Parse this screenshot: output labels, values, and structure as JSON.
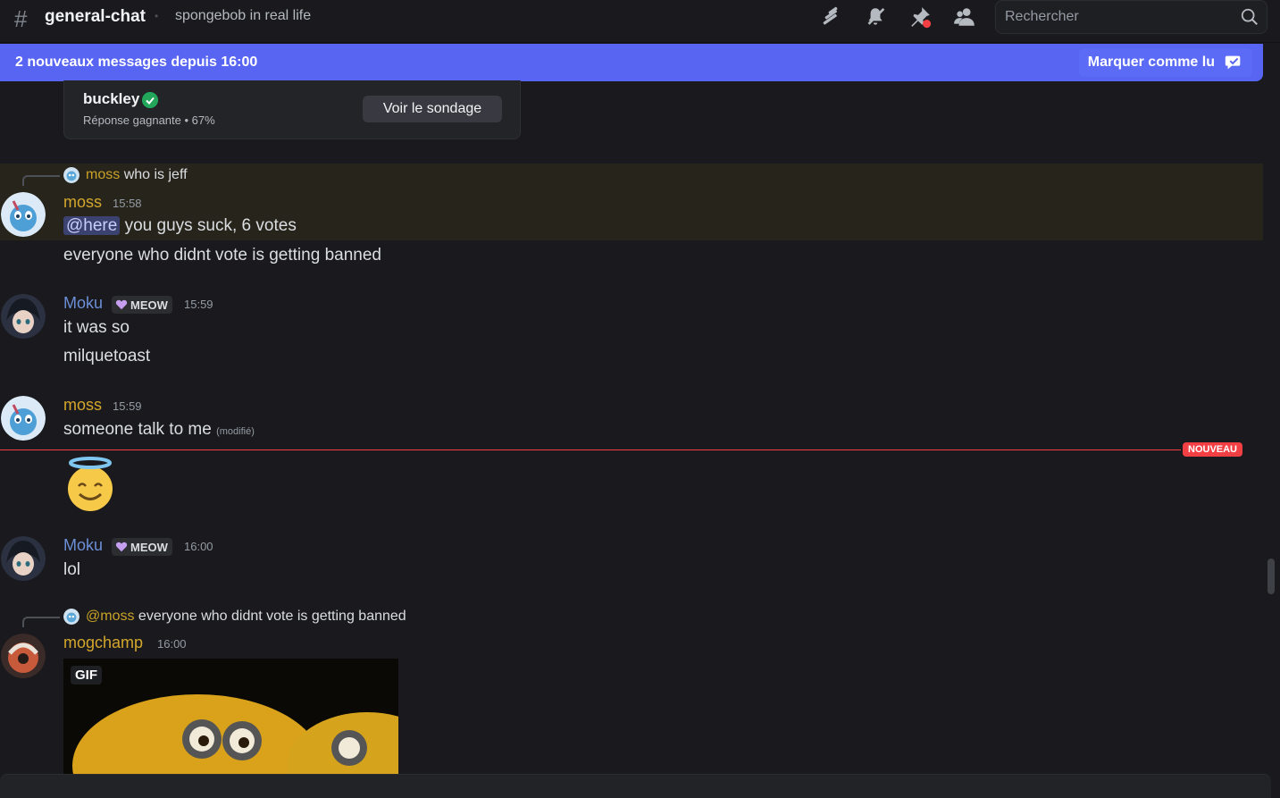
{
  "header": {
    "channel_name": "general-chat",
    "topic": "spongebob in real life",
    "search_placeholder": "Rechercher"
  },
  "new_messages_bar": {
    "text": "2 nouveaux messages depuis 16:00",
    "mark_read": "Marquer comme lu"
  },
  "poll_result": {
    "winner": "buckley",
    "subtitle": "Réponse gagnante • 67%",
    "button": "Voir le sondage"
  },
  "messages": [
    {
      "reply_name": "moss",
      "reply_text": "who is jeff",
      "author": "moss",
      "time": "15:58",
      "mention": "@here",
      "line1": " you guys suck, 6 votes",
      "line2": "everyone who didnt vote is getting banned"
    },
    {
      "author": "Moku",
      "badge": "MEOW",
      "time": "15:59",
      "line1": "it was so",
      "line2": "milquetoast"
    },
    {
      "author": "moss",
      "time": "15:59",
      "line1": "someone talk to me",
      "edited": "(modifié)"
    },
    {
      "author": "Moku",
      "badge": "MEOW",
      "time": "16:00",
      "line1": "lol"
    },
    {
      "reply_name": "@moss",
      "reply_text": "everyone who didnt vote is getting banned",
      "author": "mogchamp",
      "time": "16:00",
      "gif_label": "GIF"
    }
  ],
  "new_divider": "NOUVEAU",
  "icons": [
    "threads-icon",
    "mute-icon",
    "pin-icon",
    "members-icon",
    "search-icon",
    "mark-read-icon",
    "verified-check-icon",
    "heart-badge-icon",
    "smiling-halo-emoji"
  ],
  "colors": {
    "accent": "#5865f2",
    "new": "#f23f43",
    "moss_role": "#d4a72c",
    "moku_role": "#6b8fd6"
  }
}
